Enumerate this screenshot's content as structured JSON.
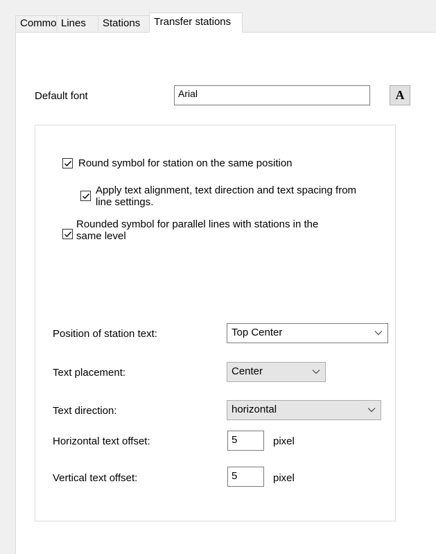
{
  "tabs": [
    "Common",
    "Lines",
    "Stations",
    "Transfer stations"
  ],
  "default_font": {
    "label": "Default font",
    "value": "Arial",
    "button_label": "A"
  },
  "options": {
    "round_symbol": {
      "label": "Round symbol for station on the same position",
      "checked": true
    },
    "apply_text": {
      "label_line1": "Apply text alignment, text direction and text spacing from",
      "label_line2": "line settings.",
      "checked": true
    },
    "rounded_parallel": {
      "label_line1": "Rounded symbol for parallel lines with stations in the",
      "label_line2": "same level",
      "checked": true
    }
  },
  "position_text": {
    "label": "Position of station text:",
    "value": "Top Center"
  },
  "text_placement": {
    "label": "Text placement:",
    "value": "Center"
  },
  "text_direction": {
    "label": "Text direction:",
    "value": "horizontal"
  },
  "horizontal_offset": {
    "label": "Horizontal text offset:",
    "value": "5",
    "unit": "pixel"
  },
  "vertical_offset": {
    "label": "Vertical text offset:",
    "value": "5",
    "unit": "pixel"
  }
}
